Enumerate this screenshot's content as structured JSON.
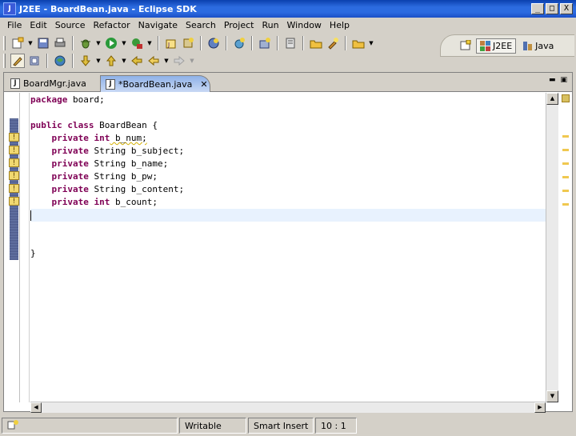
{
  "window": {
    "title": "J2EE - BoardBean.java - Eclipse SDK",
    "app_icon_letter": "J"
  },
  "window_controls": {
    "minimize": "_",
    "maximize": "□",
    "close": "X"
  },
  "menu": [
    "File",
    "Edit",
    "Source",
    "Refactor",
    "Navigate",
    "Search",
    "Project",
    "Run",
    "Window",
    "Help"
  ],
  "perspectives": [
    {
      "label": "J2EE",
      "active": true
    },
    {
      "label": "Java",
      "active": false
    }
  ],
  "tabs": [
    {
      "label": "BoardMgr.java",
      "active": false
    },
    {
      "label": "*BoardBean.java",
      "active": true
    }
  ],
  "tab_close": "✕",
  "code_lines": [
    {
      "kw": "package",
      "rest": " board;"
    },
    {
      "kw": "",
      "rest": ""
    },
    {
      "kw": "public class",
      "rest": " BoardBean {"
    },
    {
      "kw": "    private int",
      "rest": " b_num;"
    },
    {
      "kw": "    private",
      "rest": " String b_subject;"
    },
    {
      "kw": "    private",
      "rest": " String b_name;"
    },
    {
      "kw": "    private",
      "rest": " String b_pw;"
    },
    {
      "kw": "    private",
      "rest": " String b_content;"
    },
    {
      "kw": "    private int",
      "rest": " b_count;"
    },
    {
      "kw": "",
      "rest": ""
    },
    {
      "kw": "",
      "rest": ""
    },
    {
      "kw": "",
      "rest": ""
    },
    {
      "kw": "",
      "rest": "}"
    }
  ],
  "status": {
    "mode1": "Writable",
    "mode2": "Smart Insert",
    "position": "10 : 1"
  }
}
